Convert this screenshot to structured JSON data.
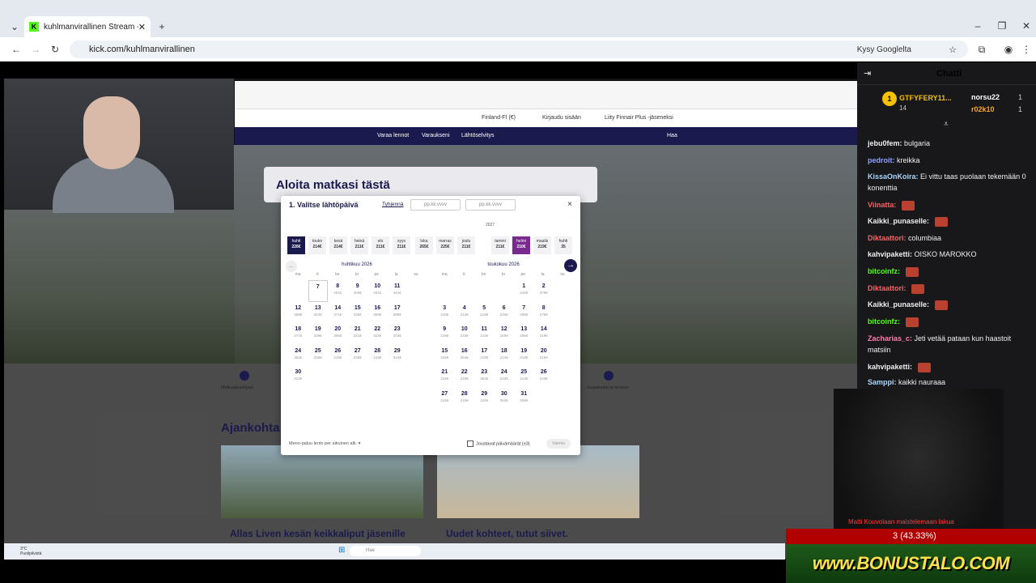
{
  "browser": {
    "tab_title": "kuhlmanvirallinen Stream - Wat",
    "url": "kick.com/kuhlmanvirallinen",
    "ask_google": "Kysy Googlelta"
  },
  "site": {
    "header_items": [
      "Finland-FI (€)",
      "Kirjaudu sisään",
      "Liity Finnair Plus -jäseneksi"
    ],
    "nav_items": [
      "Varaa lennot",
      "Varaukseni",
      "Lähtöselvitys",
      "Haa"
    ],
    "hero_title": "Aloita matkasi tästä",
    "icon_left_label": "Matkustusohjeet",
    "icon_right_label": "…tuspalvelut ja terveys",
    "section_title": "Ajankohta",
    "card1_title": "Allas Liven kesän keikkaliput jäsenille",
    "card2_title": "Uudet kohteet, tutut siivet.",
    "taskbar_weather": "3°C Puolipilvistä",
    "taskbar_search": "Hae"
  },
  "dialog": {
    "title": "1. Valitse lähtöpäivä",
    "clear": "Tyhjennä",
    "field1_placeholder": "pp.kk.vvvv",
    "field2_placeholder": "pp.kk.vvvv",
    "close": "×",
    "year_label": "2027",
    "months": [
      {
        "name": "huhti",
        "price": "226€"
      },
      {
        "name": "touko",
        "price": "214€"
      },
      {
        "name": "kesä",
        "price": "214€"
      },
      {
        "name": "heinä",
        "price": "211€"
      },
      {
        "name": "elo",
        "price": "211€"
      },
      {
        "name": "syys",
        "price": "211€"
      },
      {
        "name": "loka",
        "price": "265€"
      },
      {
        "name": "marras",
        "price": "225€"
      },
      {
        "name": "joulu",
        "price": "211€"
      },
      {
        "name": "tammi",
        "price": "211€"
      },
      {
        "name": "helmi",
        "price": "210€"
      },
      {
        "name": "maalis",
        "price": "219€"
      },
      {
        "name": "huhti",
        "price": "35"
      }
    ],
    "weekdays": [
      "ma",
      "ti",
      "ke",
      "to",
      "pe",
      "la",
      "su"
    ],
    "cal1": {
      "title": "huhtikuu 2026",
      "days": [
        {
          "d": "",
          "p": ""
        },
        {
          "d": "7",
          "p": ""
        },
        {
          "d": "8",
          "p": "401€"
        },
        {
          "d": "9",
          "p": "403€"
        },
        {
          "d": "10",
          "p": "401€"
        },
        {
          "d": "11",
          "p": "441€"
        },
        {
          "d": "12",
          "p": "369€"
        },
        {
          "d": "13",
          "p": "324€"
        },
        {
          "d": "14",
          "p": "371€"
        },
        {
          "d": "15",
          "p": "336€"
        },
        {
          "d": "16",
          "p": "359€"
        },
        {
          "d": "17",
          "p": "388€"
        },
        {
          "d": "18",
          "p": "371€"
        },
        {
          "d": "19",
          "p": "336€"
        },
        {
          "d": "20",
          "p": "305€"
        },
        {
          "d": "21",
          "p": "321€"
        },
        {
          "d": "22",
          "p": "322€"
        },
        {
          "d": "23",
          "p": "403€"
        },
        {
          "d": "24",
          "p": "362€"
        },
        {
          "d": "25",
          "p": "335€"
        },
        {
          "d": "26",
          "p": "243€"
        },
        {
          "d": "27",
          "p": "226€"
        },
        {
          "d": "28",
          "p": "243€"
        },
        {
          "d": "29",
          "p": "312€"
        },
        {
          "d": "30",
          "p": "312€"
        }
      ]
    },
    "cal2": {
      "title": "toukokuu 2026",
      "days": [
        {
          "d": "",
          "p": ""
        },
        {
          "d": "",
          "p": ""
        },
        {
          "d": "",
          "p": ""
        },
        {
          "d": "",
          "p": ""
        },
        {
          "d": "1",
          "p": "243€"
        },
        {
          "d": "2",
          "p": "378€"
        },
        {
          "d": "3",
          "p": "243€"
        },
        {
          "d": "4",
          "p": "214€"
        },
        {
          "d": "5",
          "p": "219€"
        },
        {
          "d": "6",
          "p": "233€"
        },
        {
          "d": "7",
          "p": "299€"
        },
        {
          "d": "8",
          "p": "275€"
        },
        {
          "d": "9",
          "p": "219€"
        },
        {
          "d": "10",
          "p": "243€"
        },
        {
          "d": "11",
          "p": "214€"
        },
        {
          "d": "12",
          "p": "219€"
        },
        {
          "d": "13",
          "p": "455€"
        },
        {
          "d": "14",
          "p": "219€"
        },
        {
          "d": "15",
          "p": "226€"
        },
        {
          "d": "16",
          "p": "364€"
        },
        {
          "d": "17",
          "p": "219€"
        },
        {
          "d": "18",
          "p": "214€"
        },
        {
          "d": "19",
          "p": "219€"
        },
        {
          "d": "20",
          "p": "215€"
        },
        {
          "d": "21",
          "p": "215€"
        },
        {
          "d": "22",
          "p": "219€"
        },
        {
          "d": "23",
          "p": "363€"
        },
        {
          "d": "24",
          "p": "243€"
        },
        {
          "d": "25",
          "p": "214€"
        },
        {
          "d": "26",
          "p": "243€"
        },
        {
          "d": "27",
          "p": "215€"
        },
        {
          "d": "28",
          "p": "215€"
        },
        {
          "d": "29",
          "p": "234€"
        },
        {
          "d": "30",
          "p": "362€"
        },
        {
          "d": "31",
          "p": "406€"
        }
      ]
    },
    "footer_left": "Meno-paluu lento per aikuinen alk. ▾",
    "flex_label": "Joustavat päivämäärät (±3)",
    "done": "Valmis"
  },
  "chat": {
    "header": "Chatti",
    "pinned": [
      {
        "name": "GTFYFERY11...",
        "count": "14"
      },
      {
        "name": "norsu22",
        "count": "1"
      },
      {
        "name": "r02k10",
        "count": "1"
      }
    ],
    "messages": [
      {
        "user": "jebu0fem",
        "color": "#efeff1",
        "text": "bulgaria"
      },
      {
        "user": "pedroit",
        "color": "#8ea2ff",
        "text": "kreikka"
      },
      {
        "user": "KissaOnKoira",
        "color": "#a7d7ff",
        "text": "Ei vittu taas puolaan tekemään 0 konenttia"
      },
      {
        "user": "Viinatta",
        "color": "#ff5f5f",
        "text": ""
      },
      {
        "user": "Kaikki_punaselle",
        "color": "#efeff1",
        "text": ""
      },
      {
        "user": "Diktaattori",
        "color": "#ff5f5f",
        "text": "columbiaa"
      },
      {
        "user": "kahvipaketti",
        "color": "#efeff1",
        "text": "OISKO MAROKKO"
      },
      {
        "user": "bitcoinfz",
        "color": "#53fc18",
        "text": ""
      },
      {
        "user": "Diktaattori",
        "color": "#ff5f5f",
        "text": ""
      },
      {
        "user": "Kaikki_punaselle",
        "color": "#efeff1",
        "text": ""
      },
      {
        "user": "bitcoinfz",
        "color": "#53fc18",
        "text": ""
      },
      {
        "user": "Zacharias_c",
        "color": "#ff7fae",
        "text": "Jeti vetää pataan kun haastoit matsiin"
      },
      {
        "user": "kahvipaketti",
        "color": "#efeff1",
        "text": ""
      },
      {
        "user": "Samppi",
        "color": "#a7d7ff",
        "text": "kaikki nauraaa"
      }
    ]
  },
  "overlay": {
    "red_scroller": "Matti Kouvolaan maistelemaan lakua",
    "percent": "3 (43.33%)",
    "bonus": "www.BONUSTALO.COM"
  },
  "colors": {
    "kick_green": "#53fc18",
    "finnair_navy": "#1b1a4e",
    "chat_bg": "#18181b"
  }
}
